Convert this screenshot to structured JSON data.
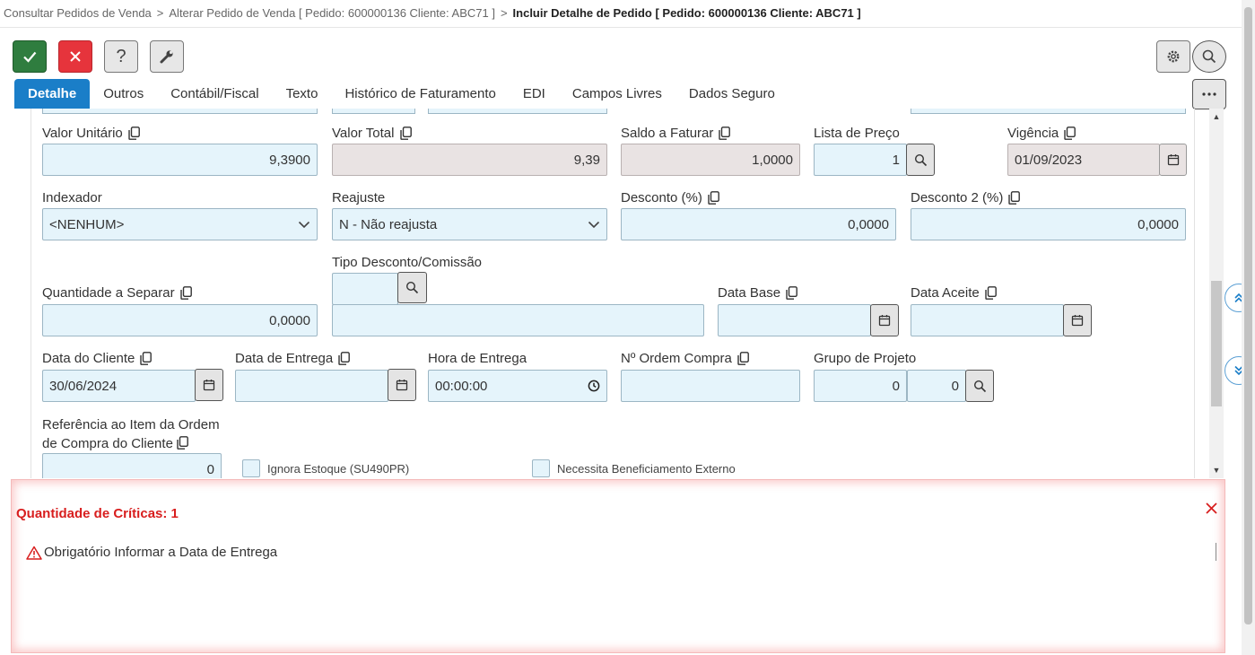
{
  "breadcrumb": {
    "item1": "Consultar Pedidos de Venda",
    "item2": "Alterar Pedido de Venda [ Pedido: 600000136 Cliente: ABC71 ]",
    "current": "Incluir Detalhe de Pedido [ Pedido: 600000136 Cliente: ABC71 ]",
    "separator": ">"
  },
  "toolbar": {
    "help_label": "?"
  },
  "tabs": [
    "Detalhe",
    "Outros",
    "Contábil/Fiscal",
    "Texto",
    "Histórico de Faturamento",
    "EDI",
    "Campos Livres",
    "Dados Seguro"
  ],
  "form": {
    "valor_unitario": {
      "label": "Valor Unitário",
      "value": "9,3900"
    },
    "valor_total": {
      "label": "Valor Total",
      "value": "9,39"
    },
    "saldo_faturar": {
      "label": "Saldo a Faturar",
      "value": "1,0000"
    },
    "lista_preco": {
      "label": "Lista de Preço",
      "value": "1"
    },
    "vigencia": {
      "label": "Vigência",
      "value": "01/09/2023"
    },
    "indexador": {
      "label": "Indexador",
      "value": "<NENHUM>"
    },
    "reajuste": {
      "label": "Reajuste",
      "value": "N - Não reajusta"
    },
    "desconto": {
      "label": "Desconto (%)",
      "value": "0,0000"
    },
    "desconto2": {
      "label": "Desconto 2 (%)",
      "value": "0,0000"
    },
    "tipo_desconto": {
      "label": "Tipo Desconto/Comissão",
      "value": "",
      "desc": ""
    },
    "qtd_separar": {
      "label": "Quantidade a Separar",
      "value": "0,0000"
    },
    "data_base": {
      "label": "Data Base",
      "value": ""
    },
    "data_aceite": {
      "label": "Data Aceite",
      "value": ""
    },
    "data_cliente": {
      "label": "Data do Cliente",
      "value": "30/06/2024"
    },
    "data_entrega": {
      "label": "Data de Entrega",
      "value": ""
    },
    "hora_entrega": {
      "label": "Hora de Entrega",
      "value": "00:00:00"
    },
    "ordem_compra": {
      "label": "Nº Ordem Compra",
      "value": ""
    },
    "grupo_projeto": {
      "label": "Grupo de Projeto",
      "value1": "0",
      "value2": "0"
    },
    "referencia": {
      "label": "Referência ao Item da Ordem de Compra do Cliente",
      "value": "0"
    },
    "ignora_estoque": {
      "label": "Ignora Estoque (SU490PR)",
      "checked": false
    },
    "beneficiamento": {
      "label": "Necessita Beneficiamento Externo",
      "checked": false
    }
  },
  "criticas": {
    "title": "Quantidade de Críticas: 1",
    "messages": [
      "Obrigatório Informar a Data de Entrega"
    ]
  },
  "colors": {
    "accent": "#1a7ec8",
    "ok": "#2f7d3f",
    "cancel": "#e6343c",
    "error": "#d81e1e",
    "field_bg": "#e5f4fb",
    "readonly_bg": "#e9e3e3"
  }
}
